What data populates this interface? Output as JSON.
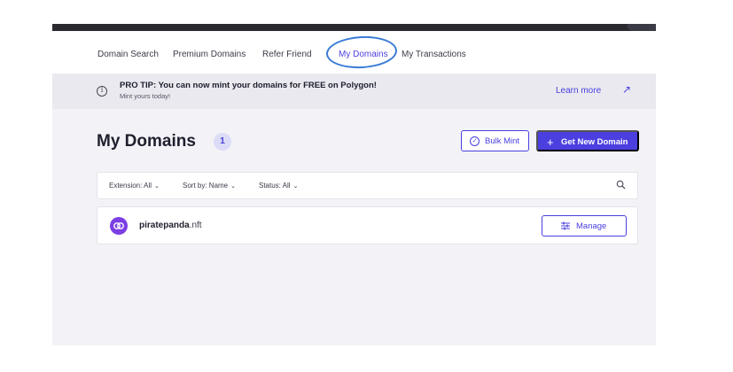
{
  "nav": {
    "items": [
      {
        "label": "Domain Search"
      },
      {
        "label": "Premium Domains"
      },
      {
        "label": "Refer Friend"
      },
      {
        "label": "My Domains"
      },
      {
        "label": "My Transactions"
      }
    ],
    "active_index": 3
  },
  "tip": {
    "title": "PRO TIP: You can now mint your domains for FREE on Polygon!",
    "subtitle": "Mint yours today!",
    "link_label": "Learn more",
    "link_icon": "arrow-up-right-icon",
    "info_icon": "info-circle-icon"
  },
  "page": {
    "title": "My Domains",
    "count": "1"
  },
  "actions": {
    "bulk_mint_label": "Bulk Mint",
    "bulk_mint_icon": "check-circle-icon",
    "new_domain_label": "Get New Domain",
    "new_domain_icon": "plus-icon"
  },
  "filters": {
    "extension": "Extension: All",
    "sort": "Sort by: Name",
    "status": "Status: All",
    "search_icon": "search-icon"
  },
  "domains": [
    {
      "sld": "piratepanda",
      "tld": ".nft",
      "icon": "polygon-logo-icon",
      "manage_label": "Manage",
      "manage_icon": "sliders-icon"
    }
  ],
  "colors": {
    "accent": "#4b3fe0",
    "avatar": "#7b3fe4",
    "badge_bg": "#dcdcf7",
    "tip_bg": "#e9e9ef",
    "annotation": "#3a7bd5"
  }
}
